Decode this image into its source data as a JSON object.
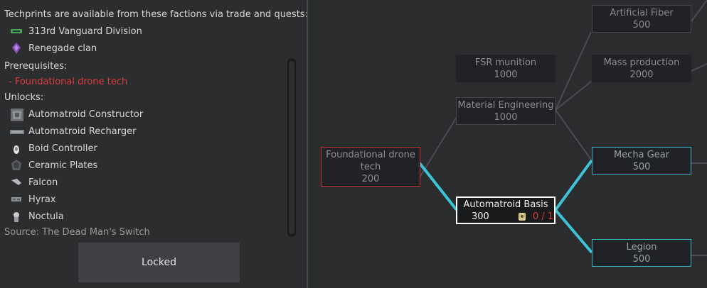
{
  "info": {
    "techprints_heading": "Techprints are available from these factions via trade and quests:",
    "factions": [
      {
        "name": "313rd Vanguard Division",
        "icon": "vanguard-faction-icon",
        "color": "#4aa35a"
      },
      {
        "name": "Renegade clan",
        "icon": "renegade-faction-icon",
        "color": "#8a4fb8"
      }
    ],
    "prereq_heading": "Prerequisites:",
    "prerequisites": [
      "- Foundational drone tech"
    ],
    "unlocks_heading": "Unlocks:",
    "unlocks": [
      {
        "name": "Automatroid Constructor",
        "icon": "constructor-icon"
      },
      {
        "name": "Automatroid Recharger",
        "icon": "recharger-icon"
      },
      {
        "name": "Boid Controller",
        "icon": "boid-controller-icon"
      },
      {
        "name": "Ceramic Plates",
        "icon": "ceramic-plates-icon"
      },
      {
        "name": "Falcon",
        "icon": "falcon-icon"
      },
      {
        "name": "Hyrax",
        "icon": "hyrax-icon"
      },
      {
        "name": "Noctula",
        "icon": "noctula-icon"
      }
    ],
    "source": "Source:  The Dead Man's Switch",
    "locked_label": "Locked"
  },
  "tree": {
    "nodes": {
      "artificial_fiber": {
        "name": "Artificial Fiber",
        "cost": "500"
      },
      "fsr_munition": {
        "name": "FSR munition",
        "cost": "1000"
      },
      "mass_production": {
        "name": "Mass production",
        "cost": "2000"
      },
      "material_engineering": {
        "name": "Material Engineering",
        "cost": "1000"
      },
      "foundational_drone": {
        "name": "Foundational drone tech",
        "cost": "200"
      },
      "mecha_gear": {
        "name": "Mecha Gear",
        "cost": "500"
      },
      "automatroid_basis": {
        "name": "Automatroid Basis",
        "cost": "300",
        "techprints": "0 / 1"
      },
      "legion": {
        "name": "Legion",
        "cost": "500"
      }
    },
    "colors": {
      "link_active": "#3cc4d6",
      "link_inactive": "#4a4c4f",
      "prereq_missing": "#c8323a",
      "selected": "#ffffff"
    }
  }
}
